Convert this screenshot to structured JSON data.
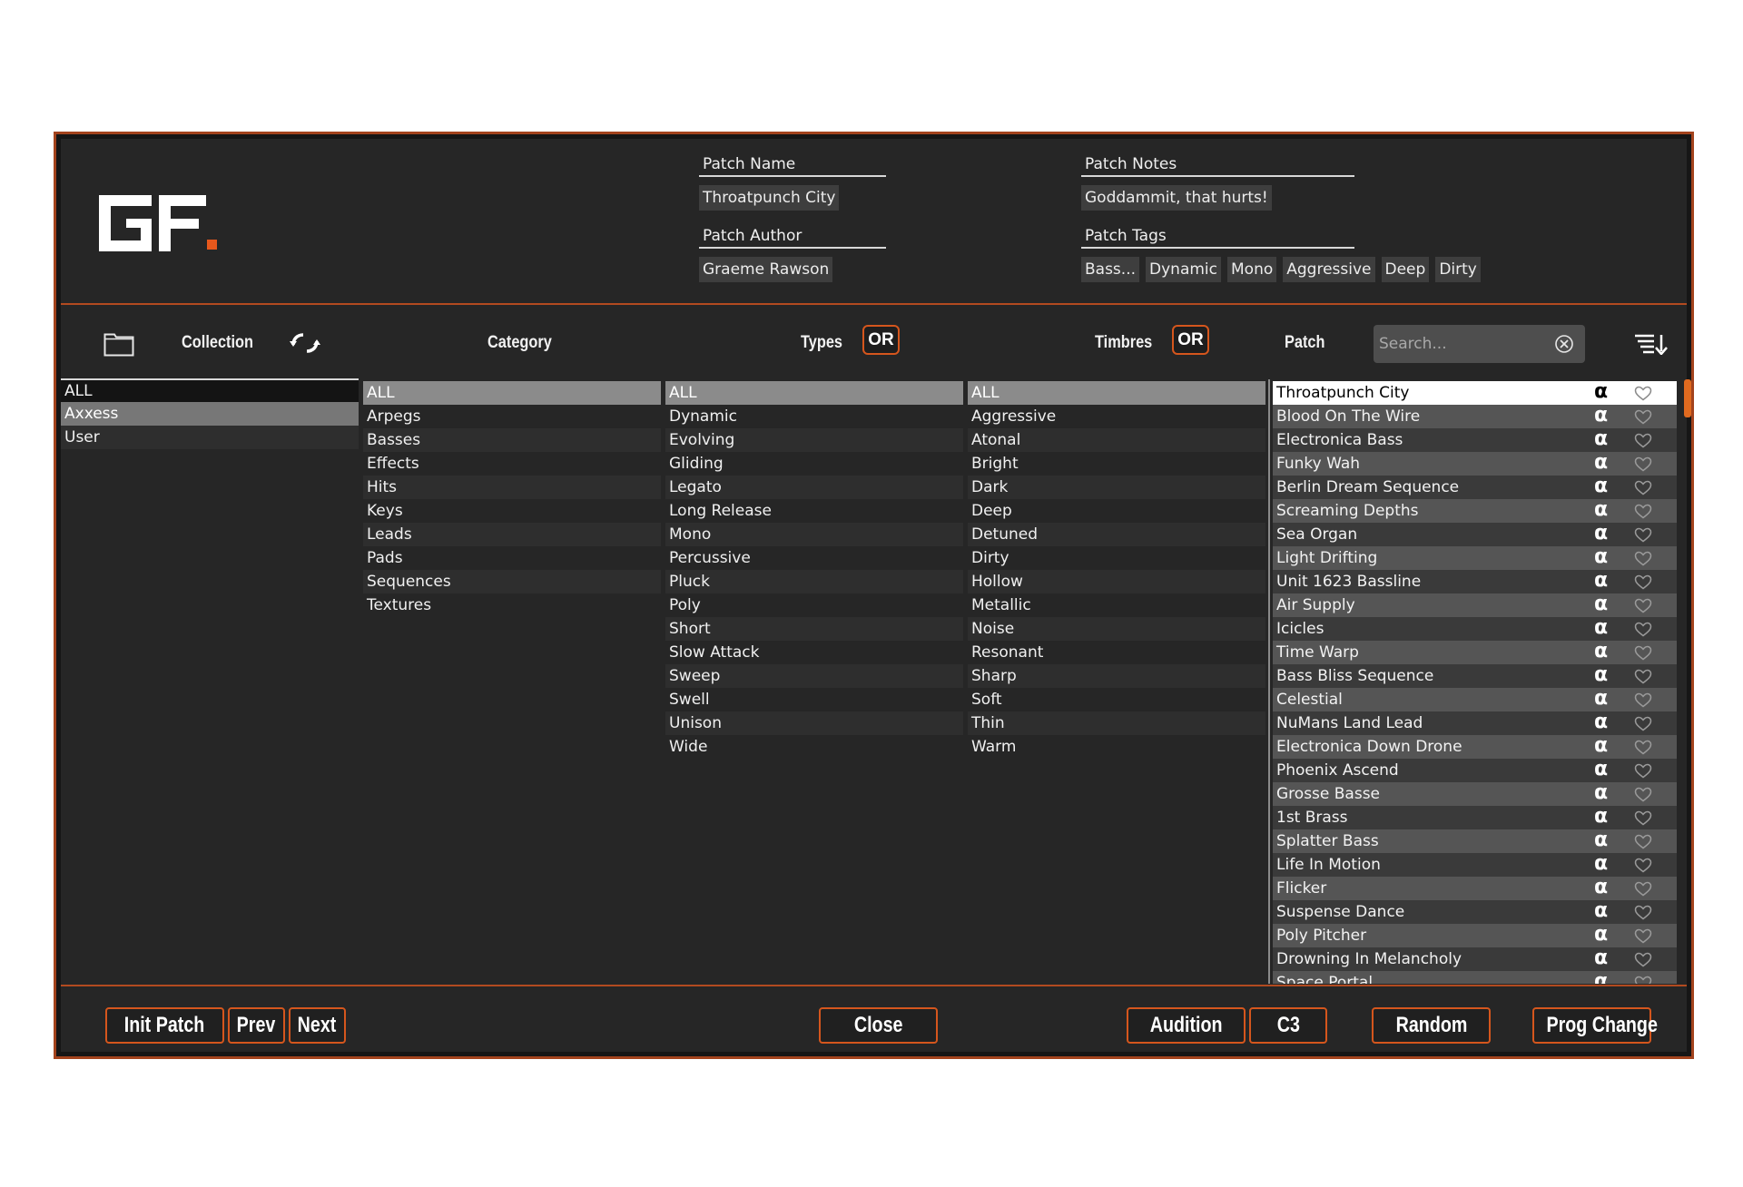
{
  "header": {
    "patch_name_label": "Patch Name",
    "patch_name": "Throatpunch City",
    "patch_author_label": "Patch Author",
    "patch_author": "Graeme Rawson",
    "patch_notes_label": "Patch Notes",
    "patch_notes": "Goddammit, that hurts!",
    "patch_tags_label": "Patch Tags",
    "patch_tags": [
      "Bass...",
      "Dynamic",
      "Mono",
      "Aggressive",
      "Deep",
      "Dirty"
    ]
  },
  "toolbar": {
    "collection_label": "Collection",
    "category_label": "Category",
    "types_label": "Types",
    "types_mode": "OR",
    "timbres_label": "Timbres",
    "timbres_mode": "OR",
    "patch_label": "Patch",
    "search_placeholder": "Search..."
  },
  "collection": [
    "ALL",
    "Axxess",
    "User"
  ],
  "category": [
    "ALL",
    "Arpegs",
    "Basses",
    "Effects",
    "Hits",
    "Keys",
    "Leads",
    "Pads",
    "Sequences",
    "Textures"
  ],
  "types": [
    "ALL",
    "Dynamic",
    "Evolving",
    "Gliding",
    "Legato",
    "Long Release",
    "Mono",
    "Percussive",
    "Pluck",
    "Poly",
    "Short",
    "Slow Attack",
    "Sweep",
    "Swell",
    "Unison",
    "Wide"
  ],
  "timbres": [
    "ALL",
    "Aggressive",
    "Atonal",
    "Bright",
    "Dark",
    "Deep",
    "Detuned",
    "Dirty",
    "Hollow",
    "Metallic",
    "Noise",
    "Resonant",
    "Sharp",
    "Soft",
    "Thin",
    "Warm"
  ],
  "patches": [
    "Throatpunch City",
    "Blood On The Wire",
    "Electronica Bass",
    "Funky Wah",
    "Berlin Dream Sequence",
    "Screaming Depths",
    "Sea Organ",
    "Light Drifting",
    "Unit 1623 Bassline",
    "Air Supply",
    "Icicles",
    "Time Warp",
    "Bass Bliss Sequence",
    "Celestial",
    "NuMans Land Lead",
    "Electronica Down Drone",
    "Phoenix Ascend",
    "Grosse Basse",
    "1st Brass",
    "Splatter Bass",
    "Life In Motion",
    "Flicker",
    "Suspense Dance",
    "Poly Pitcher",
    "Drowning In Melancholy",
    "Space Portal"
  ],
  "alpha_glyph": "α",
  "footer": {
    "init_patch": "Init Patch",
    "prev": "Prev",
    "next": "Next",
    "close": "Close",
    "audition": "Audition",
    "note": "C3",
    "random": "Random",
    "prog_change": "Prog Change"
  },
  "colors": {
    "accent": "#d5561d",
    "border": "#a3431d",
    "background": "#262626"
  }
}
